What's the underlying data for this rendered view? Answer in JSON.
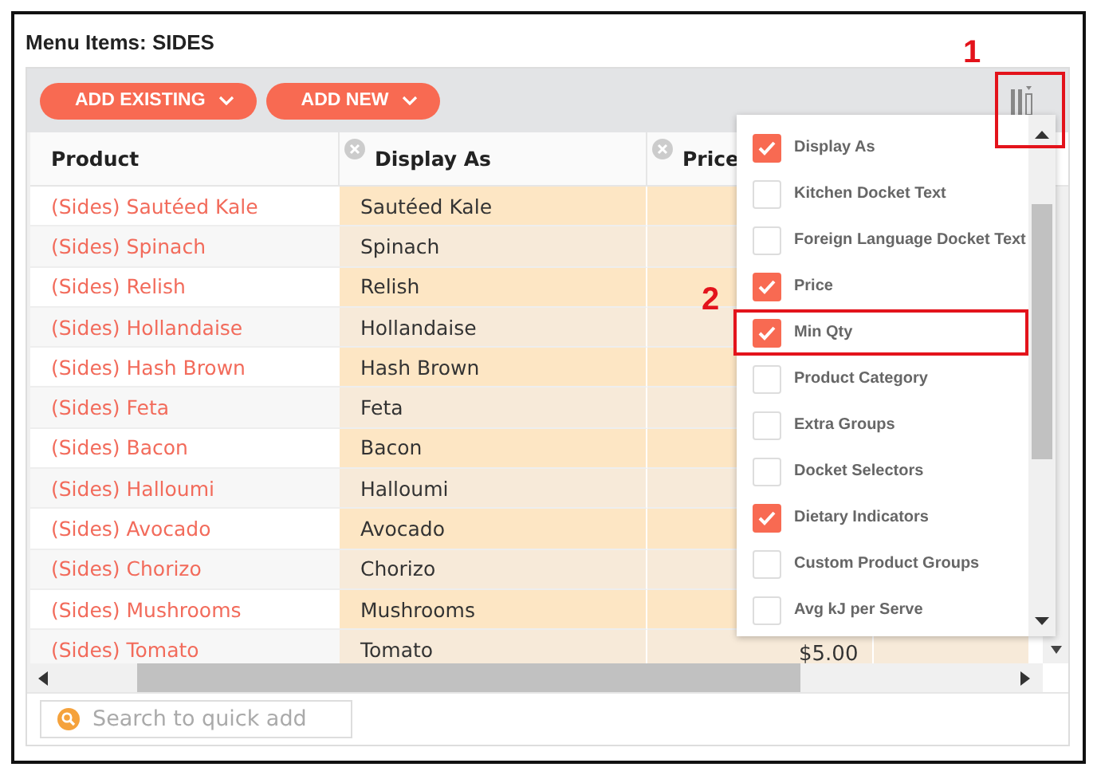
{
  "title": "Menu Items: SIDES",
  "toolbar": {
    "buttons": [
      {
        "label": "ADD EXISTING"
      },
      {
        "label": "ADD NEW"
      }
    ]
  },
  "table": {
    "columns": [
      {
        "label": "Product",
        "removable": false
      },
      {
        "label": "Display As",
        "removable": true
      },
      {
        "label": "Price",
        "removable": true
      }
    ],
    "rows": [
      {
        "product": "(Sides) Sautéed Kale",
        "display": "Sautéed Kale"
      },
      {
        "product": "(Sides) Spinach",
        "display": "Spinach"
      },
      {
        "product": "(Sides) Relish",
        "display": "Relish"
      },
      {
        "product": "(Sides) Hollandaise",
        "display": "Hollandaise"
      },
      {
        "product": "(Sides) Hash Brown",
        "display": "Hash Brown"
      },
      {
        "product": "(Sides) Feta",
        "display": "Feta"
      },
      {
        "product": "(Sides) Bacon",
        "display": "Bacon"
      },
      {
        "product": "(Sides) Halloumi",
        "display": "Halloumi"
      },
      {
        "product": "(Sides) Avocado",
        "display": "Avocado"
      },
      {
        "product": "(Sides) Chorizo",
        "display": "Chorizo"
      },
      {
        "product": "(Sides) Mushrooms",
        "display": "Mushrooms"
      },
      {
        "product": "(Sides) Tomato",
        "display": "Tomato",
        "price": "$5.00"
      }
    ]
  },
  "column_menu": {
    "items": [
      {
        "label": "Display As",
        "checked": true,
        "highlighted": false
      },
      {
        "label": "Kitchen Docket Text",
        "checked": false,
        "highlighted": false
      },
      {
        "label": "Foreign Language Docket Text",
        "checked": false,
        "highlighted": false
      },
      {
        "label": "Price",
        "checked": true,
        "highlighted": false
      },
      {
        "label": "Min Qty",
        "checked": true,
        "highlighted": true
      },
      {
        "label": "Product Category",
        "checked": false,
        "highlighted": false
      },
      {
        "label": "Extra Groups",
        "checked": false,
        "highlighted": false
      },
      {
        "label": "Docket Selectors",
        "checked": false,
        "highlighted": false
      },
      {
        "label": "Dietary Indicators",
        "checked": true,
        "highlighted": false
      },
      {
        "label": "Custom Product Groups",
        "checked": false,
        "highlighted": false
      },
      {
        "label": "Avg kJ per Serve",
        "checked": false,
        "highlighted": false
      }
    ]
  },
  "callouts": [
    {
      "label": "1"
    },
    {
      "label": "2"
    }
  ],
  "search": {
    "placeholder": "Search to quick add"
  }
}
